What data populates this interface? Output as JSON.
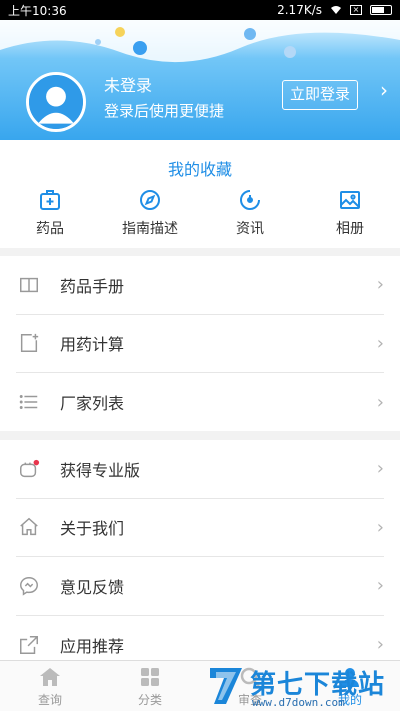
{
  "status_bar": {
    "time": "上午10:36",
    "speed": "2.17K/s"
  },
  "profile": {
    "name": "未登录",
    "subtitle": "登录后使用更便捷",
    "login_label": "立即登录",
    "chevron": "›"
  },
  "favorites": {
    "title": "我的收藏",
    "items": [
      {
        "label": "药品",
        "icon": "medicine-box-icon"
      },
      {
        "label": "指南描述",
        "icon": "compass-icon"
      },
      {
        "label": "资讯",
        "icon": "news-icon"
      },
      {
        "label": "相册",
        "icon": "photo-icon"
      }
    ]
  },
  "menu1": [
    {
      "label": "药品手册",
      "icon": "book-icon"
    },
    {
      "label": "用药计算",
      "icon": "calculator-icon"
    },
    {
      "label": "厂家列表",
      "icon": "list-icon"
    }
  ],
  "menu2": [
    {
      "label": "获得专业版",
      "icon": "pro-icon"
    },
    {
      "label": "关于我们",
      "icon": "home-icon"
    },
    {
      "label": "意见反馈",
      "icon": "feedback-icon"
    },
    {
      "label": "应用推荐",
      "icon": "share-icon"
    }
  ],
  "chevron": "›",
  "tabbar": [
    {
      "label": "查询",
      "icon": "home-tab-icon",
      "active": false
    },
    {
      "label": "分类",
      "icon": "grid-tab-icon",
      "active": false
    },
    {
      "label": "审查",
      "icon": "review-tab-icon",
      "active": false
    },
    {
      "label": "我的",
      "icon": "me-tab-icon",
      "active": true
    }
  ],
  "watermark": {
    "brand": "第七下载站",
    "url": "www.d7down.com"
  },
  "colors": {
    "accent": "#1f8ee6",
    "header_blue": "#38a6ee",
    "chevron_gray": "#b3b3b3"
  }
}
